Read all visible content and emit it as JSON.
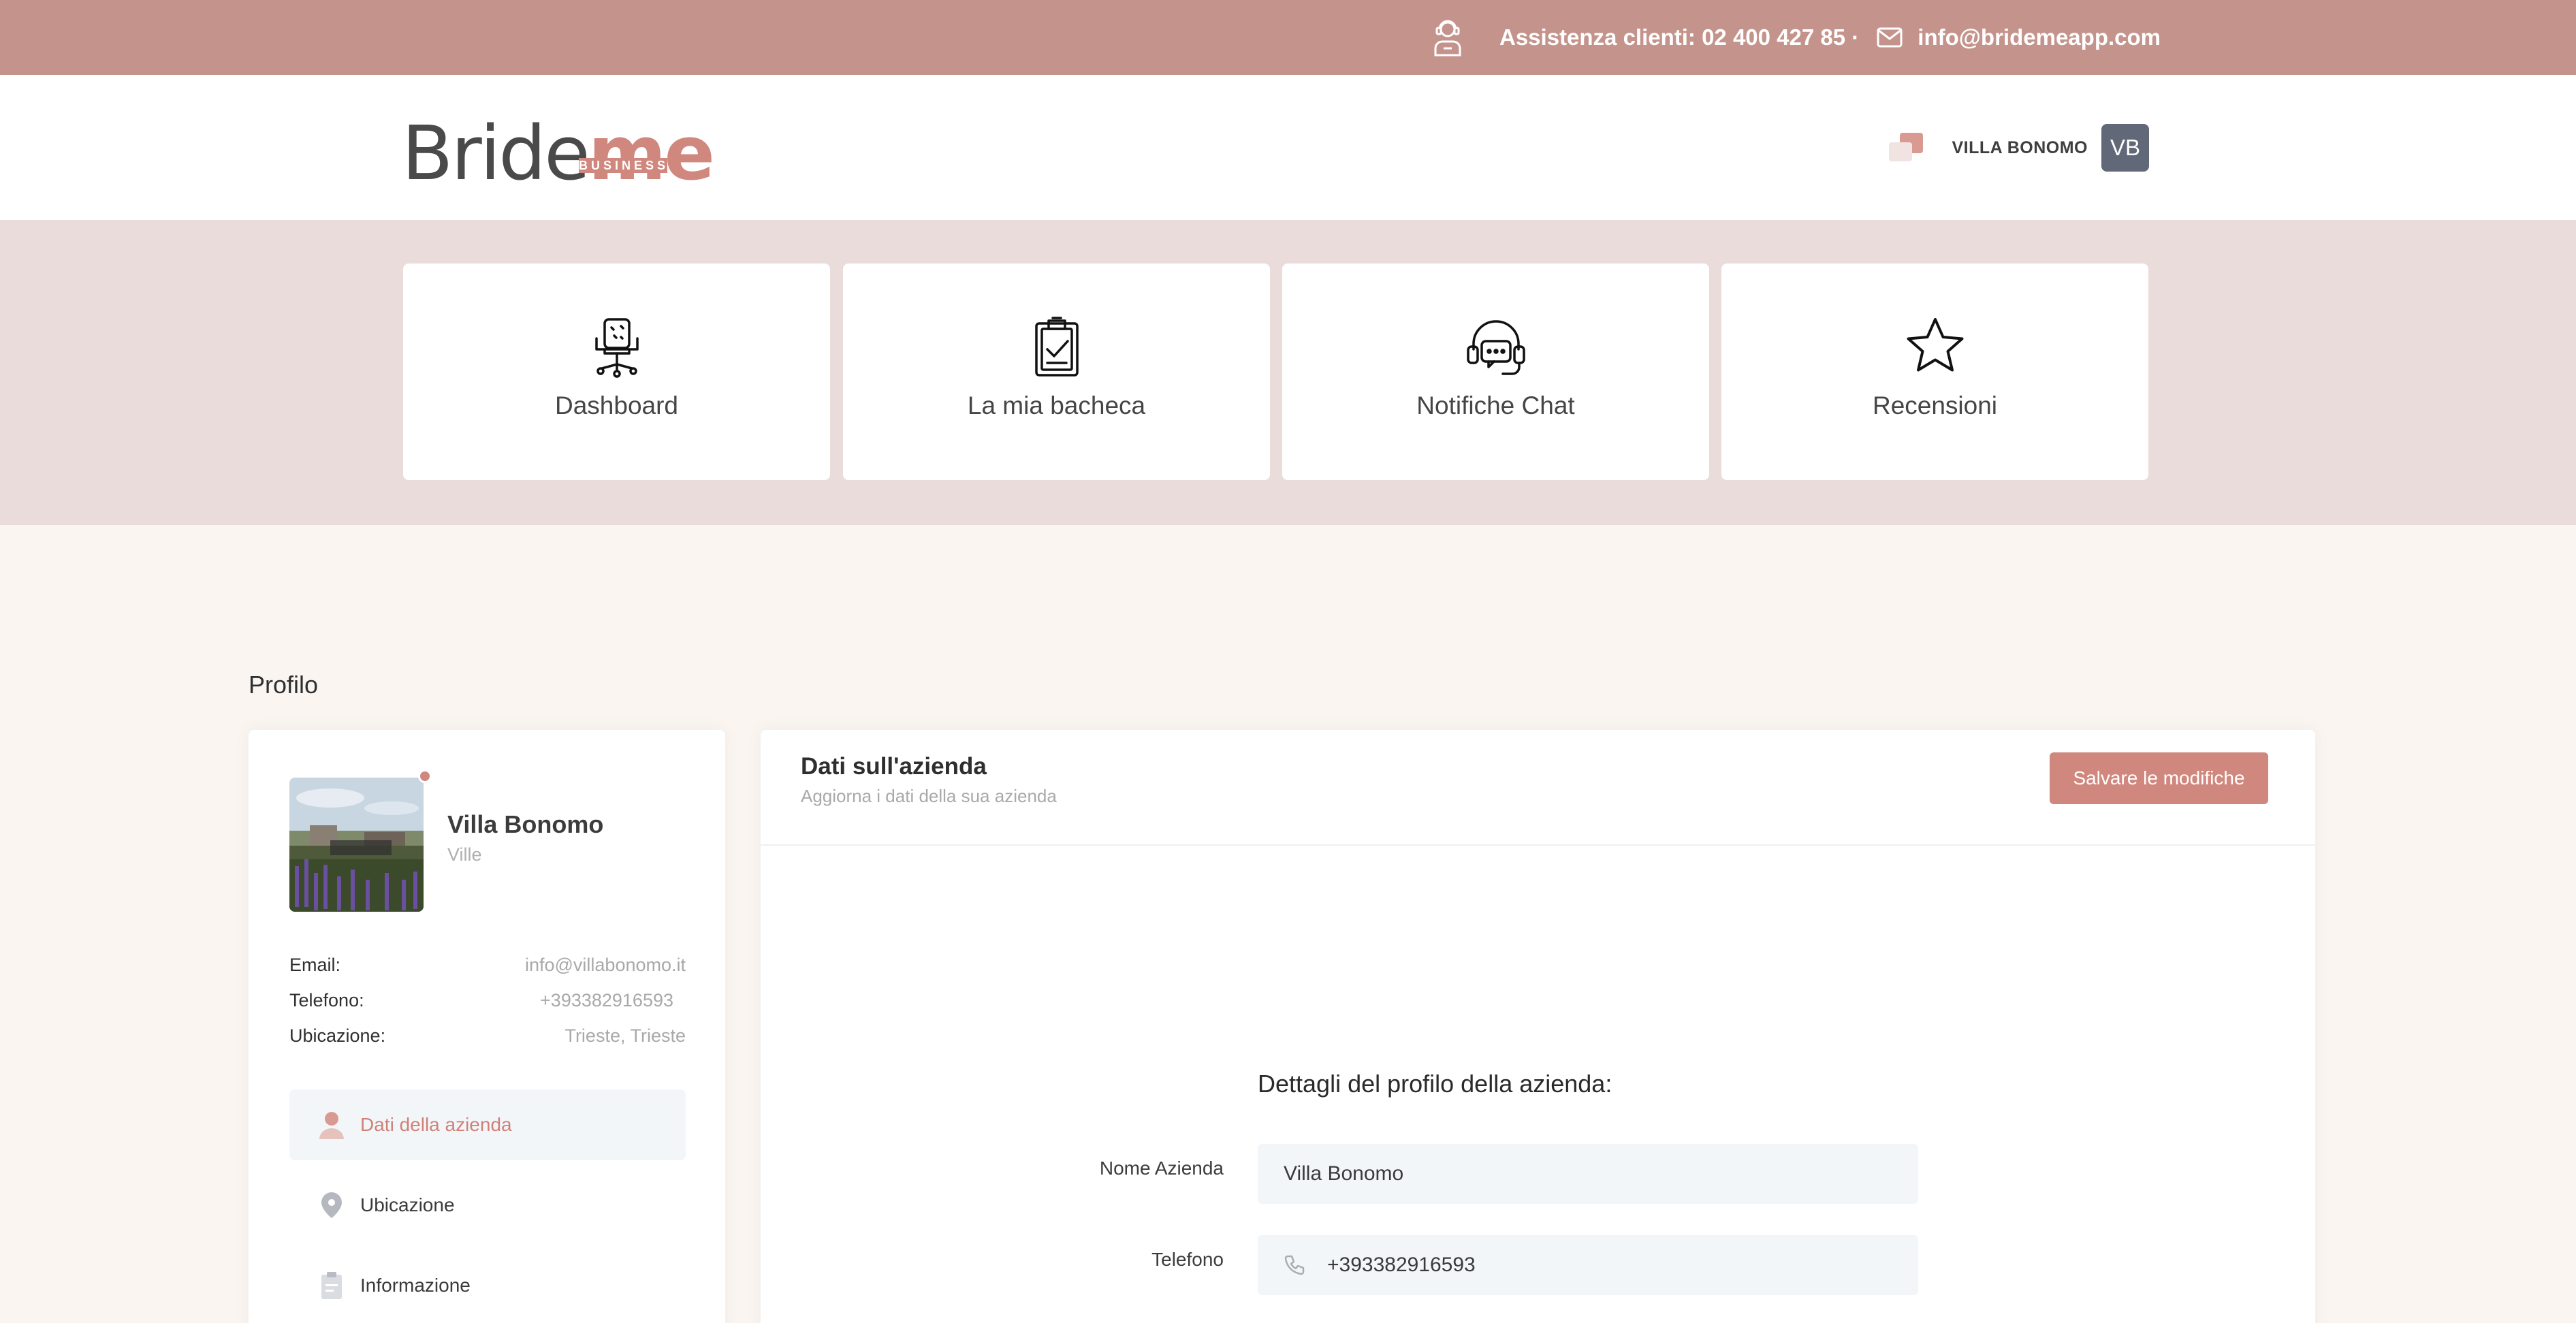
{
  "topbar": {
    "support_text": "Assistenza clienti: 02 400 427 85 ·",
    "email": "info@bridemeapp.com"
  },
  "header": {
    "logo_part1": "Bride",
    "logo_part2": "me",
    "logo_badge": "BUSINESS",
    "user_name": "VILLA BONOMO",
    "avatar_initials": "VB"
  },
  "nav": {
    "tiles": [
      {
        "label": "Dashboard",
        "icon": "office-chair-icon"
      },
      {
        "label": "La mia bacheca",
        "icon": "clipboard-icon"
      },
      {
        "label": "Notifiche Chat",
        "icon": "headset-icon"
      },
      {
        "label": "Recensioni",
        "icon": "star-icon"
      }
    ]
  },
  "page": {
    "title": "Profilo"
  },
  "profile": {
    "name": "Villa Bonomo",
    "category": "Ville",
    "email_label": "Email:",
    "email_value": "info@villabonomo.it",
    "phone_label": "Telefono:",
    "phone_value": "+393382916593",
    "location_label": "Ubicazione:",
    "location_value": "Trieste, Trieste",
    "menu": [
      {
        "label": "Dati della azienda",
        "active": true,
        "icon": "user-icon"
      },
      {
        "label": "Ubicazione",
        "active": false,
        "icon": "map-pin-icon"
      },
      {
        "label": "Informazione",
        "active": false,
        "icon": "clipboard-icon"
      }
    ]
  },
  "company": {
    "title": "Dati sull'azienda",
    "subtitle": "Aggiorna i dati della sua azienda",
    "save_label": "Salvare le modifiche",
    "section_title": "Dettagli del profilo della azienda:",
    "fields": {
      "name_label": "Nome Azienda",
      "name_value": "Villa Bonomo",
      "phone_label": "Telefono",
      "phone_value": "+393382916593"
    }
  },
  "colors": {
    "topbar": "#c4948c",
    "accent": "#d0877d",
    "nav_band": "#eadcdb",
    "page_bg": "#faf5f1",
    "avatar_bg": "#616877",
    "field_bg": "#f3f6f9"
  }
}
